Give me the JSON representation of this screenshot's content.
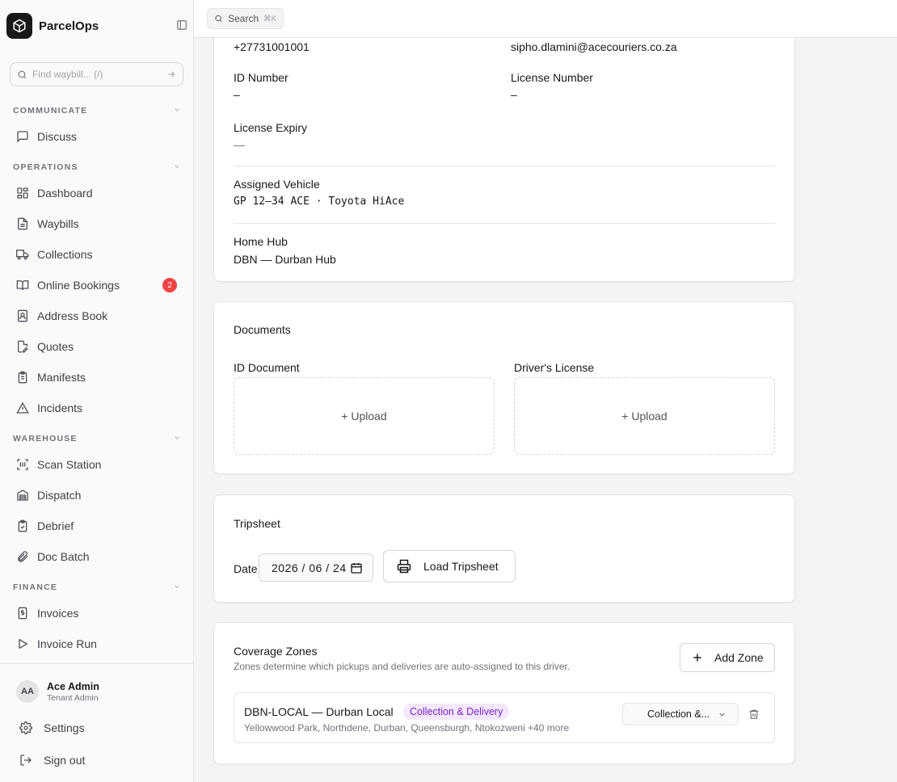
{
  "app": {
    "name": "ParcelOps"
  },
  "sidebar": {
    "find_placeholder": "Find waybill... (/)",
    "sections": {
      "communicate": "COMMUNICATE",
      "operations": "OPERATIONS",
      "warehouse": "WAREHOUSE",
      "finance": "FINANCE"
    },
    "items": {
      "discuss": "Discuss",
      "dashboard": "Dashboard",
      "waybills": "Waybills",
      "collections": "Collections",
      "online_bookings": "Online Bookings",
      "online_bookings_badge": "2",
      "address_book": "Address Book",
      "quotes": "Quotes",
      "manifests": "Manifests",
      "incidents": "Incidents",
      "scan_station": "Scan Station",
      "dispatch": "Dispatch",
      "debrief": "Debrief",
      "doc_batch": "Doc Batch",
      "invoices": "Invoices",
      "invoice_run": "Invoice Run"
    },
    "user": {
      "initials": "AA",
      "name": "Ace Admin",
      "role": "Tenant Admin"
    },
    "settings": "Settings",
    "sign_out": "Sign out"
  },
  "topbar": {
    "search_label": "Search",
    "search_shortcut": "⌘K"
  },
  "driver": {
    "phone": "+27731001001",
    "email": "sipho.dlamini@acecouriers.co.za",
    "id_number_label": "ID Number",
    "id_number_value": "–",
    "license_number_label": "License Number",
    "license_number_value": "–",
    "license_expiry_label": "License Expiry",
    "license_expiry_value": "—",
    "vehicle_label": "Assigned Vehicle",
    "vehicle_value": "GP 12–34 ACE · Toyota HiAce",
    "hub_label": "Home Hub",
    "hub_value": "DBN — Durban Hub"
  },
  "documents": {
    "title": "Documents",
    "id_doc_label": "ID Document",
    "license_doc_label": "Driver's License",
    "upload_label": "+ Upload"
  },
  "tripsheet": {
    "title": "Tripsheet",
    "date_label": "Date",
    "date_value": "2026 / 06 / 24",
    "load_button": "Load Tripsheet"
  },
  "zones": {
    "title": "Coverage Zones",
    "description": "Zones determine which pickups and deliveries are auto-assigned to this driver.",
    "add_button": "Add Zone",
    "rows": [
      {
        "name": "DBN-LOCAL — Durban Local",
        "tag": "Collection & Delivery",
        "areas": "Yellowwood Park, Northdene, Durban, Queensburgh, Ntokozweni +40 more",
        "select_value": "Collection &..."
      }
    ]
  },
  "colors": {
    "accent": "#18181b",
    "badge": "#ef4444",
    "tag_bg": "#f3e8ff",
    "tag_text": "#7e22ce"
  }
}
